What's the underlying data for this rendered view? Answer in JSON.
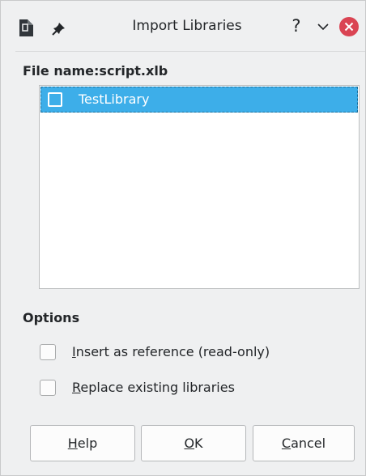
{
  "window": {
    "title": "Import Libraries",
    "help_glyph": "?",
    "icons": {
      "app": "document-icon",
      "pin": "pin-icon",
      "chevron": "chevron-down-icon",
      "close": "close-icon"
    }
  },
  "file": {
    "label": "File name:script.xlb"
  },
  "libraries": {
    "items": [
      {
        "label": "TestLibrary",
        "checked": false,
        "selected": true
      }
    ]
  },
  "options": {
    "heading": "Options",
    "insert_reference": {
      "mnemonic": "I",
      "rest": "nsert as reference (read-only)",
      "checked": false
    },
    "replace_existing": {
      "mnemonic": "R",
      "rest": "eplace existing libraries",
      "checked": false
    }
  },
  "buttons": {
    "help": {
      "mnemonic": "H",
      "rest": "elp"
    },
    "ok": {
      "mnemonic": "O",
      "rest": "K"
    },
    "cancel": {
      "mnemonic": "C",
      "rest": "ancel"
    }
  },
  "colors": {
    "selection": "#3daee9",
    "close_button": "#da4453",
    "window_bg": "#eff0f1"
  }
}
